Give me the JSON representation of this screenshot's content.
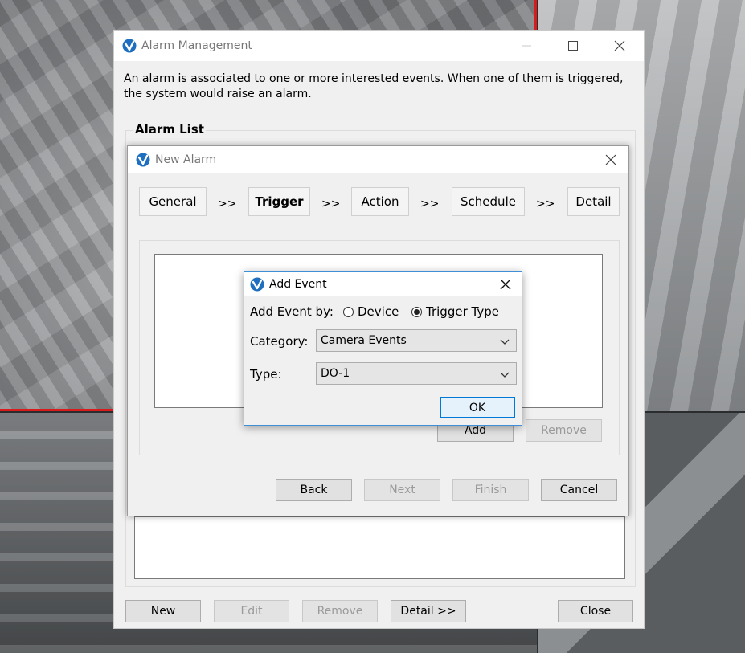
{
  "alarm_management": {
    "title": "Alarm Management",
    "description": "An alarm is associated to one or more interested events. When one of them is triggered, the system would raise an alarm.",
    "group_label": "Alarm List",
    "buttons": {
      "new": "New",
      "edit": "Edit",
      "remove": "Remove",
      "detail": "Detail >>",
      "close": "Close"
    }
  },
  "new_alarm": {
    "title": "New Alarm",
    "steps": [
      "General",
      "Trigger",
      "Action",
      "Schedule",
      "Detail"
    ],
    "separator": ">>",
    "active_step": "Trigger",
    "buttons": {
      "add": "Add",
      "remove": "Remove",
      "back": "Back",
      "next": "Next",
      "finish": "Finish",
      "cancel": "Cancel"
    }
  },
  "add_event": {
    "title": "Add Event",
    "add_by_label": "Add Event by:",
    "options": {
      "device": "Device",
      "trigger_type": "Trigger Type"
    },
    "selected_option": "trigger_type",
    "category_label": "Category:",
    "category_value": "Camera Events",
    "type_label": "Type:",
    "type_value": "DO-1",
    "ok": "OK"
  },
  "colors": {
    "accent": "#0078d7",
    "alert_border": "#d81b1b",
    "window_bg": "#f0f0f0",
    "brand_blue": "#1e6fbf"
  },
  "icons": [
    "app-logo-icon",
    "minimize-icon",
    "maximize-icon",
    "close-icon",
    "chevron-down-icon"
  ]
}
